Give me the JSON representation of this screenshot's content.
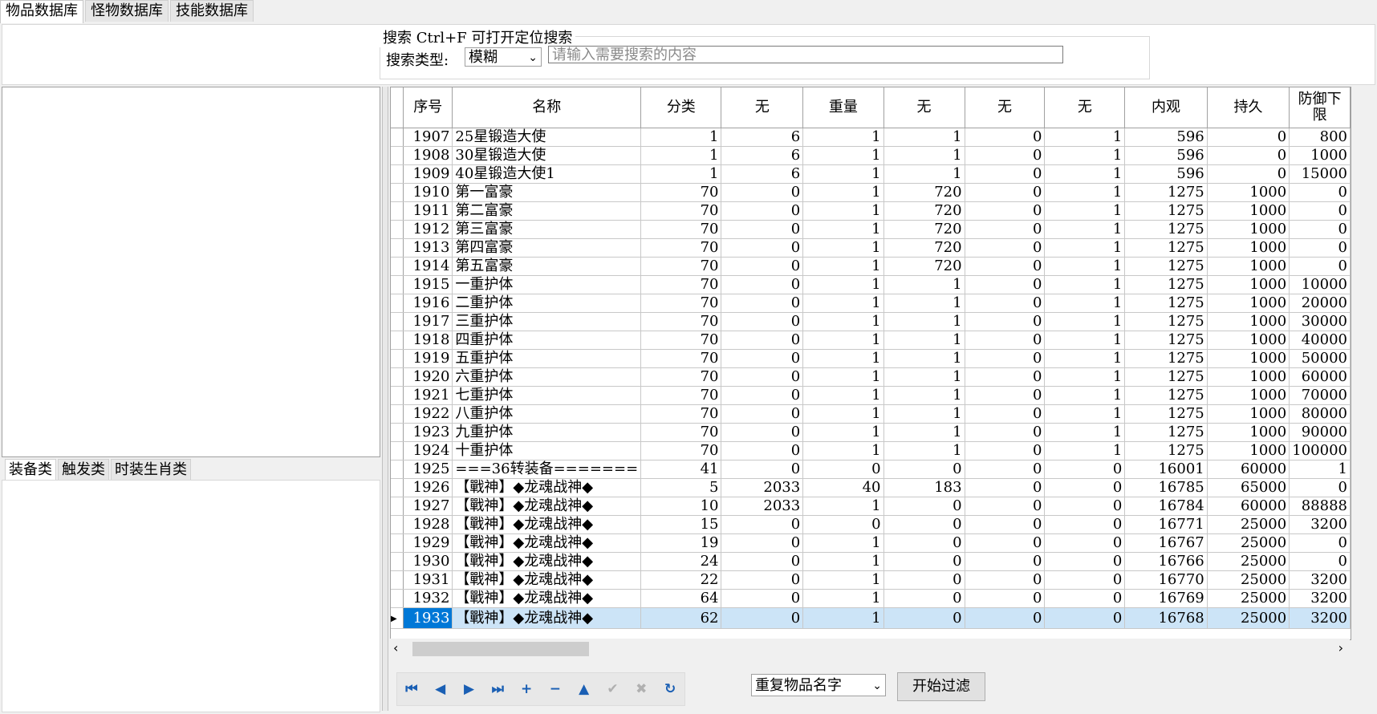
{
  "tabs": [
    "物品数据库",
    "怪物数据库",
    "技能数据库"
  ],
  "search": {
    "legend": "搜索  Ctrl+F 可打开定位搜索",
    "type_label": "搜索类型:",
    "type_value": "模糊",
    "placeholder": "请输入需要搜索的内容"
  },
  "left_tabs": [
    "装备类",
    "触发类",
    "时装生肖类"
  ],
  "grid": {
    "columns": [
      "序号",
      "名称",
      "分类",
      "无",
      "重量",
      "无",
      "无",
      "无",
      "内观",
      "持久",
      "防御下限"
    ],
    "rows": [
      [
        "1907",
        "25星锻造大使",
        "1",
        "6",
        "1",
        "1",
        "0",
        "1",
        "596",
        "0",
        "800"
      ],
      [
        "1908",
        "30星锻造大使",
        "1",
        "6",
        "1",
        "1",
        "0",
        "1",
        "596",
        "0",
        "1000"
      ],
      [
        "1909",
        "40星锻造大使1",
        "1",
        "6",
        "1",
        "1",
        "0",
        "1",
        "596",
        "0",
        "15000"
      ],
      [
        "1910",
        "第一富豪",
        "70",
        "0",
        "1",
        "720",
        "0",
        "1",
        "1275",
        "1000",
        "0"
      ],
      [
        "1911",
        "第二富豪",
        "70",
        "0",
        "1",
        "720",
        "0",
        "1",
        "1275",
        "1000",
        "0"
      ],
      [
        "1912",
        "第三富豪",
        "70",
        "0",
        "1",
        "720",
        "0",
        "1",
        "1275",
        "1000",
        "0"
      ],
      [
        "1913",
        "第四富豪",
        "70",
        "0",
        "1",
        "720",
        "0",
        "1",
        "1275",
        "1000",
        "0"
      ],
      [
        "1914",
        "第五富豪",
        "70",
        "0",
        "1",
        "720",
        "0",
        "1",
        "1275",
        "1000",
        "0"
      ],
      [
        "1915",
        "一重护体",
        "70",
        "0",
        "1",
        "1",
        "0",
        "1",
        "1275",
        "1000",
        "10000"
      ],
      [
        "1916",
        "二重护体",
        "70",
        "0",
        "1",
        "1",
        "0",
        "1",
        "1275",
        "1000",
        "20000"
      ],
      [
        "1917",
        "三重护体",
        "70",
        "0",
        "1",
        "1",
        "0",
        "1",
        "1275",
        "1000",
        "30000"
      ],
      [
        "1918",
        "四重护体",
        "70",
        "0",
        "1",
        "1",
        "0",
        "1",
        "1275",
        "1000",
        "40000"
      ],
      [
        "1919",
        "五重护体",
        "70",
        "0",
        "1",
        "1",
        "0",
        "1",
        "1275",
        "1000",
        "50000"
      ],
      [
        "1920",
        "六重护体",
        "70",
        "0",
        "1",
        "1",
        "0",
        "1",
        "1275",
        "1000",
        "60000"
      ],
      [
        "1921",
        "七重护体",
        "70",
        "0",
        "1",
        "1",
        "0",
        "1",
        "1275",
        "1000",
        "70000"
      ],
      [
        "1922",
        "八重护体",
        "70",
        "0",
        "1",
        "1",
        "0",
        "1",
        "1275",
        "1000",
        "80000"
      ],
      [
        "1923",
        "九重护体",
        "70",
        "0",
        "1",
        "1",
        "0",
        "1",
        "1275",
        "1000",
        "90000"
      ],
      [
        "1924",
        "十重护体",
        "70",
        "0",
        "1",
        "1",
        "0",
        "1",
        "1275",
        "1000",
        "100000"
      ],
      [
        "1925",
        "===36转装备=======",
        "41",
        "0",
        "0",
        "0",
        "0",
        "0",
        "16001",
        "60000",
        "1"
      ],
      [
        "1926",
        "【戰神】◆龙魂战神◆",
        "5",
        "2033",
        "40",
        "183",
        "0",
        "0",
        "16785",
        "65000",
        "0"
      ],
      [
        "1927",
        "【戰神】◆龙魂战神◆",
        "10",
        "2033",
        "1",
        "0",
        "0",
        "0",
        "16784",
        "60000",
        "88888"
      ],
      [
        "1928",
        "【戰神】◆龙魂战神◆",
        "15",
        "0",
        "0",
        "0",
        "0",
        "0",
        "16771",
        "25000",
        "3200"
      ],
      [
        "1929",
        "【戰神】◆龙魂战神◆",
        "19",
        "0",
        "1",
        "0",
        "0",
        "0",
        "16767",
        "25000",
        "0"
      ],
      [
        "1930",
        "【戰神】◆龙魂战神◆",
        "24",
        "0",
        "1",
        "0",
        "0",
        "0",
        "16766",
        "25000",
        "0"
      ],
      [
        "1931",
        "【戰神】◆龙魂战神◆",
        "22",
        "0",
        "1",
        "0",
        "0",
        "0",
        "16770",
        "25000",
        "3200"
      ],
      [
        "1932",
        "【戰神】◆龙魂战神◆",
        "64",
        "0",
        "1",
        "0",
        "0",
        "0",
        "16769",
        "25000",
        "3200"
      ],
      [
        "1933",
        "【戰神】◆龙魂战神◆",
        "62",
        "0",
        "1",
        "0",
        "0",
        "0",
        "16768",
        "25000",
        "3200"
      ]
    ],
    "selected_row": 26
  },
  "nav_icons": [
    {
      "name": "first-record-icon",
      "glyph": "⏮",
      "enabled": true
    },
    {
      "name": "prior-record-icon",
      "glyph": "◀",
      "enabled": true
    },
    {
      "name": "next-record-icon",
      "glyph": "▶",
      "enabled": true
    },
    {
      "name": "last-record-icon",
      "glyph": "⏭",
      "enabled": true
    },
    {
      "name": "insert-record-icon",
      "glyph": "+",
      "enabled": true
    },
    {
      "name": "delete-record-icon",
      "glyph": "−",
      "enabled": true
    },
    {
      "name": "edit-record-icon",
      "glyph": "▲",
      "enabled": true
    },
    {
      "name": "post-record-icon",
      "glyph": "✔",
      "enabled": false
    },
    {
      "name": "cancel-record-icon",
      "glyph": "✖",
      "enabled": false
    },
    {
      "name": "refresh-record-icon",
      "glyph": "↻",
      "enabled": true
    }
  ],
  "filter": {
    "select_value": "重复物品名字",
    "button_label": "开始过滤"
  },
  "colors": {
    "selection_highlight": "#cce4f7",
    "selected_cell": "#0078d7",
    "nav_icon": "#1a5fb4"
  }
}
